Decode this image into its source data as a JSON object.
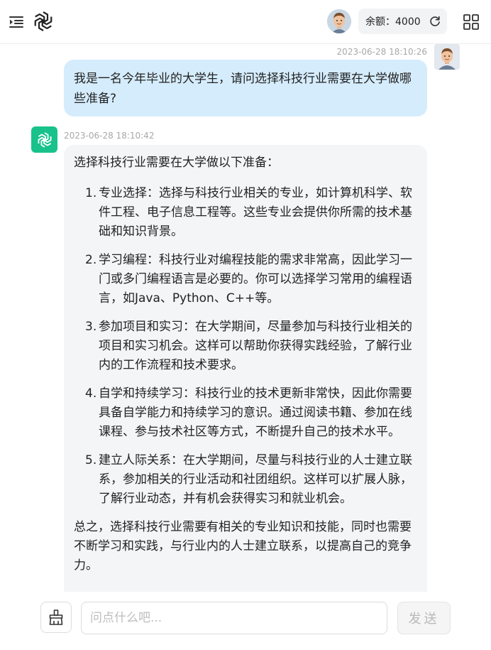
{
  "header": {
    "balance_label": "余额：4000"
  },
  "conversation": {
    "user_message": {
      "time": "2023-06-28 18:10:26",
      "text": "我是一名今年毕业的大学生，请问选择科技行业需要在大学做哪些准备?"
    },
    "ai_message": {
      "time": "2023-06-28 18:10:42",
      "intro": "选择科技行业需要在大学做以下准备：",
      "items": [
        {
          "num": "1.",
          "text": "专业选择：选择与科技行业相关的专业，如计算机科学、软件工程、电子信息工程等。这些专业会提供你所需的技术基础和知识背景。"
        },
        {
          "num": "2.",
          "text": "学习编程：科技行业对编程技能的需求非常高，因此学习一门或多门编程语言是必要的。你可以选择学习常用的编程语言，如Java、Python、C++等。"
        },
        {
          "num": "3.",
          "text": "参加项目和实习：在大学期间，尽量参加与科技行业相关的项目和实习机会。这样可以帮助你获得实践经验，了解行业内的工作流程和技术要求。"
        },
        {
          "num": "4.",
          "text": "自学和持续学习：科技行业的技术更新非常快，因此你需要具备自学能力和持续学习的意识。通过阅读书籍、参加在线课程、参与技术社区等方式，不断提升自己的技术水平。"
        },
        {
          "num": "5.",
          "text": "建立人际关系：在大学期间，尽量与科技行业的人士建立联系，参加相关的行业活动和社团组织。这样可以扩展人脉，了解行业动态，并有机会获得实习和就业机会。"
        }
      ],
      "conclusion": "总之，选择科技行业需要有相关的专业知识和技能，同时也需要不断学习和实践，与行业内的人士建立联系，以提高自己的竞争力。"
    }
  },
  "footer": {
    "input_placeholder": "问点什么吧...",
    "input_value": "",
    "send_label": "发送"
  },
  "icons": {
    "menu": "menu-indent-icon",
    "logo": "openai-logo-icon",
    "refresh": "refresh-icon",
    "apps": "grid-apps-icon",
    "clear": "broom-icon"
  },
  "colors": {
    "user_bubble": "#d5ecfc",
    "ai_bubble": "#f4f5f7",
    "ai_avatar": "#18c28a",
    "timestamp": "#a8a8a8"
  }
}
